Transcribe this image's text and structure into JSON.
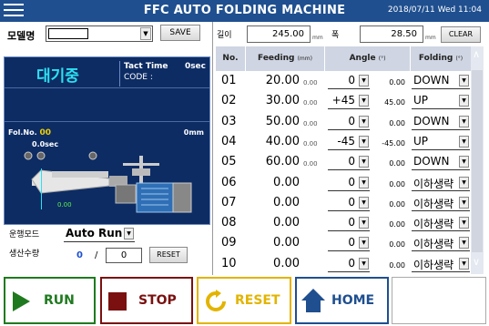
{
  "titlebar": {
    "title": "FFC AUTO FOLDING MACHINE",
    "datetime": "2018/07/11  Wed 11:04"
  },
  "model": {
    "label": "모델명",
    "value": "",
    "save_label": "SAVE"
  },
  "dimensions": {
    "length_label": "길이",
    "length_value": "245.00",
    "length_unit": "mm",
    "width_label": "폭",
    "width_value": "28.50",
    "width_unit": "mm",
    "clear_label": "CLEAR"
  },
  "status": {
    "state": "대기중",
    "tact_label": "Tact Time",
    "tact_value": "0sec",
    "code_label": "CODE :",
    "fol_label": "Fol.No.",
    "fol_value": "00",
    "fol_mm": "0mm",
    "sec_value": "0.0sec",
    "small_value": "0.00"
  },
  "operation": {
    "mode_label": "운행모드",
    "mode_value": "Auto Run",
    "count_label": "생산수량",
    "count_done": "0",
    "count_sep": "/",
    "count_target": "0",
    "reset_label": "RESET"
  },
  "table": {
    "headers": {
      "no": "No.",
      "feeding": "Feeding",
      "feeding_unit": "(mm)",
      "angle": "Angle",
      "angle_unit": "(°)",
      "folding": "Folding",
      "folding_unit": "(°)"
    },
    "rows": [
      {
        "no": "01",
        "feeding": "20.00",
        "fsub": "0.00",
        "angle": "0",
        "asub": "0.00",
        "folding": "DOWN"
      },
      {
        "no": "02",
        "feeding": "30.00",
        "fsub": "0.00",
        "angle": "+45",
        "asub": "45.00",
        "folding": "UP"
      },
      {
        "no": "03",
        "feeding": "50.00",
        "fsub": "0.00",
        "angle": "0",
        "asub": "0.00",
        "folding": "DOWN"
      },
      {
        "no": "04",
        "feeding": "40.00",
        "fsub": "0.00",
        "angle": "-45",
        "asub": "-45.00",
        "folding": "UP"
      },
      {
        "no": "05",
        "feeding": "60.00",
        "fsub": "0.00",
        "angle": "0",
        "asub": "0.00",
        "folding": "DOWN"
      },
      {
        "no": "06",
        "feeding": "0.00",
        "fsub": "",
        "angle": "0",
        "asub": "0.00",
        "folding": "이하생략"
      },
      {
        "no": "07",
        "feeding": "0.00",
        "fsub": "",
        "angle": "0",
        "asub": "0.00",
        "folding": "이하생략"
      },
      {
        "no": "08",
        "feeding": "0.00",
        "fsub": "",
        "angle": "0",
        "asub": "0.00",
        "folding": "이하생략"
      },
      {
        "no": "09",
        "feeding": "0.00",
        "fsub": "",
        "angle": "0",
        "asub": "0.00",
        "folding": "이하생략"
      },
      {
        "no": "10",
        "feeding": "0.00",
        "fsub": "",
        "angle": "0",
        "asub": "0.00",
        "folding": "이하생략"
      }
    ]
  },
  "buttons": {
    "run": "RUN",
    "stop": "STOP",
    "reset": "RESET",
    "home": "HOME"
  },
  "colors": {
    "titlebar": "#1f4f8f",
    "panel": "#0d2c64",
    "accent_cyan": "#2ce0f0",
    "run": "#1f7a1f",
    "stop": "#7a1010",
    "reset": "#e2b400",
    "home": "#1f4f8f"
  }
}
